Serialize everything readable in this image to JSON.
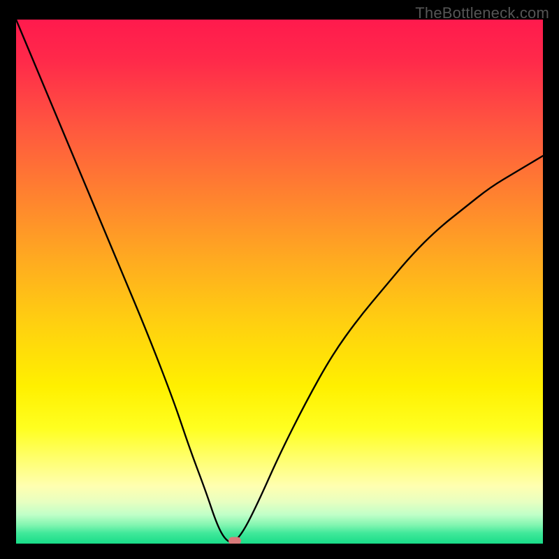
{
  "watermark": "TheBottleneck.com",
  "colors": {
    "background": "#000000",
    "curve": "#000000",
    "marker": "#d97a7a",
    "watermark_text": "#555555"
  },
  "chart_data": {
    "type": "line",
    "title": "",
    "xlabel": "",
    "ylabel": "",
    "xlim": [
      0,
      100
    ],
    "ylim": [
      0,
      100
    ],
    "notes": "Bottleneck percentage curve. X axis represents component balance position; Y axis represents bottleneck percentage (0 at bottom = no bottleneck / green, 100 at top = severe bottleneck / red). Curve reaches minimum near x≈41. Values estimated from pixel positions; no axis tick labels are rendered in the image.",
    "series": [
      {
        "name": "bottleneck-curve",
        "x": [
          0,
          5,
          10,
          15,
          20,
          25,
          30,
          33,
          36,
          38,
          39.5,
          41,
          43,
          46,
          50,
          55,
          60,
          65,
          70,
          75,
          80,
          85,
          90,
          95,
          100
        ],
        "values": [
          100,
          88,
          76,
          64,
          52,
          40,
          27,
          18,
          10,
          4,
          1,
          0,
          2,
          8,
          17,
          27,
          36,
          43,
          49,
          55,
          60,
          64,
          68,
          71,
          74
        ]
      }
    ],
    "marker": {
      "x": 41.5,
      "y": 0.5
    },
    "gradient_stops": [
      {
        "pos": 0,
        "color": "#ff1a4d"
      },
      {
        "pos": 0.33,
        "color": "#ff8030"
      },
      {
        "pos": 0.7,
        "color": "#fff000"
      },
      {
        "pos": 0.92,
        "color": "#e8ffc0"
      },
      {
        "pos": 1.0,
        "color": "#18dd88"
      }
    ]
  }
}
